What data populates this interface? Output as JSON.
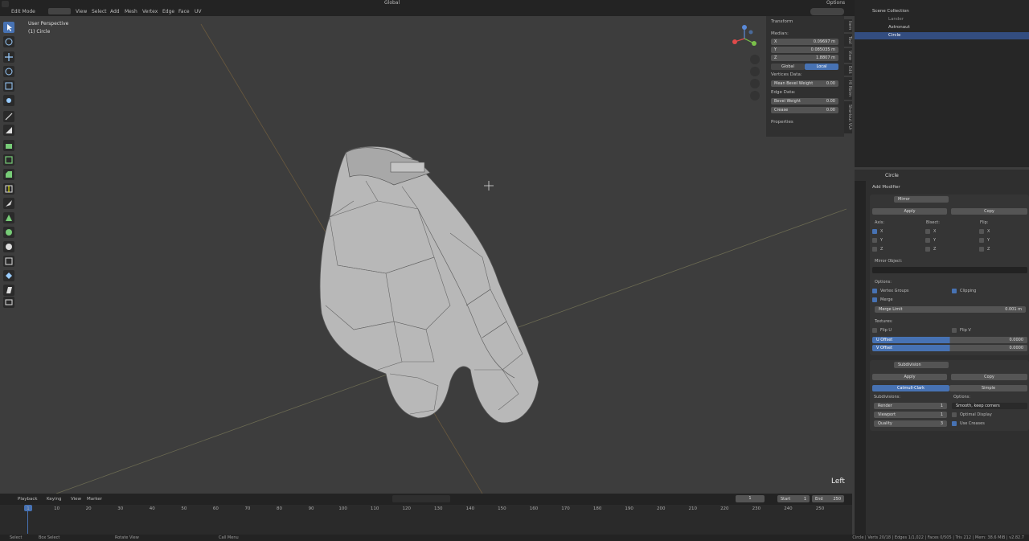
{
  "header": {
    "mode": "Edit Mode",
    "menus": [
      "View",
      "Select",
      "Add",
      "Mesh",
      "Vertex",
      "Edge",
      "Face",
      "UV"
    ],
    "orientation": "Global",
    "options_label": "Options"
  },
  "viewport": {
    "view_name": "User Perspective",
    "object_name": "(1) Circle",
    "view_label": "Left"
  },
  "npanel": {
    "transform_title": "Transform",
    "median_label": "Median:",
    "x": {
      "k": "X",
      "v": "0.09697 m"
    },
    "y": {
      "k": "Y",
      "v": "0.085035 m"
    },
    "z": {
      "k": "Z",
      "v": "1.8807 m"
    },
    "global_label": "Global",
    "local_label": "Local",
    "vertices_data": "Vertices Data:",
    "mean_bevel": {
      "k": "Mean Bevel Weight",
      "v": "0.00"
    },
    "edge_data": "Edge Data:",
    "bevel_weight": {
      "k": "Bevel Weight",
      "v": "0.00"
    },
    "crease": {
      "k": "Crease",
      "v": "0.00"
    },
    "properties_title": "Properties",
    "tabs": [
      "Item",
      "Tool",
      "View",
      "Edit",
      "HI Rbtm",
      "Shortcut VUr"
    ]
  },
  "outliner": {
    "rows": [
      {
        "label": "Scene Collection"
      },
      {
        "label": "Lander"
      },
      {
        "label": "Astronaut"
      },
      {
        "label": "Circle"
      }
    ]
  },
  "properties": {
    "object_name": "Circle",
    "add_modifier": "Add Modifier",
    "mirror": {
      "name": "Mirror",
      "apply": "Apply",
      "copy": "Copy",
      "axis_label": "Axis:",
      "bisect_label": "Bisect:",
      "flip_label": "Flip:",
      "axes": [
        "X",
        "Y",
        "Z"
      ],
      "mirror_object_label": "Mirror Object:",
      "options_label": "Options:",
      "vertex_groups": "Vertex Groups",
      "clipping": "Clipping",
      "merge": "Merge",
      "merge_limit": {
        "k": "Merge Limit",
        "v": "0.001 m"
      },
      "textures_label": "Textures:",
      "flip_u": "Flip U",
      "flip_v": "Flip V",
      "u_offset": {
        "k": "U Offset",
        "v": "0.0000"
      },
      "v_offset": {
        "k": "V Offset",
        "v": "0.0000"
      }
    },
    "subsurf": {
      "name": "Subdivision",
      "apply": "Apply",
      "copy": "Copy",
      "catmull": "Catmull-Clark",
      "simple": "Simple",
      "subdivisions_label": "Subdivisions:",
      "options_label": "Options:",
      "render": {
        "k": "Render",
        "v": "1"
      },
      "viewport": {
        "k": "Viewport",
        "v": "1"
      },
      "quality": {
        "k": "Quality",
        "v": "3"
      },
      "uv_smooth": "Smooth, keep corners",
      "optimal_display": "Optimal Display",
      "use_creases": "Use Creases"
    }
  },
  "timeline": {
    "menus": [
      "Playback",
      "Keying",
      "View",
      "Marker"
    ],
    "current_frame": "1",
    "start_label": "Start",
    "start_value": "1",
    "end_label": "End",
    "end_value": "250",
    "ticks": [
      "1",
      "10",
      "20",
      "30",
      "40",
      "50",
      "60",
      "70",
      "80",
      "90",
      "100",
      "110",
      "120",
      "130",
      "140",
      "150",
      "160",
      "170",
      "180",
      "190",
      "200",
      "210",
      "220",
      "230",
      "240",
      "250"
    ]
  },
  "statusbar": {
    "select": "Select",
    "box_select": "Box Select",
    "rotate_view": "Rotate View",
    "call_menu": "Call Menu",
    "stats": "Circle | Verts 20/18 | Edges 1/1,022 | Faces 0/505 | Tris 212 | Mem: 38.6 MiB | v2.82.7"
  },
  "colors": {
    "accent": "#4772b3",
    "viewport_bg": "#3d3d3d",
    "panel_bg": "#2f2f2f"
  }
}
